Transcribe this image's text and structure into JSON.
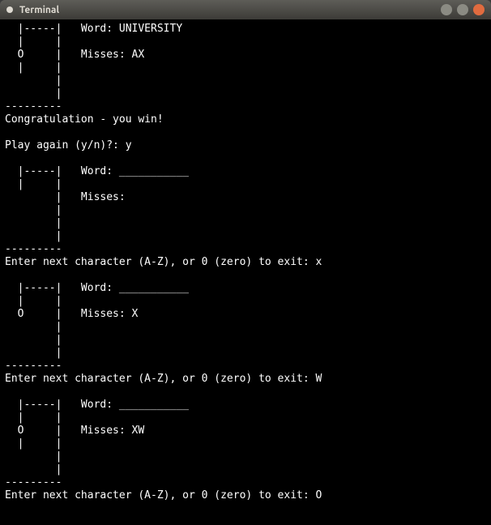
{
  "titlebar": {
    "title": "Terminal"
  },
  "game": {
    "round1": {
      "gallows": [
        "  |-----|   Word: UNIVERSITY",
        "  |     |",
        "  O     |   Misses: AX",
        "  |     |",
        "        |",
        "        |",
        "---------"
      ],
      "win_msg": "Congratulation - you win!",
      "play_again_prompt": "Play again (y/n)?: ",
      "play_again_answer": "y"
    },
    "round2": {
      "gallows": [
        "  |-----|   Word: ___________",
        "  |     |",
        "        |   Misses:",
        "        |",
        "        |",
        "        |",
        "---------"
      ],
      "prompt": "Enter next character (A-Z), or 0 (zero) to exit: ",
      "input": "x"
    },
    "round3": {
      "gallows": [
        "  |-----|   Word: ___________",
        "  |     |",
        "  O     |   Misses: X",
        "        |",
        "        |",
        "        |",
        "---------"
      ],
      "prompt": "Enter next character (A-Z), or 0 (zero) to exit: ",
      "input": "W"
    },
    "round4": {
      "gallows": [
        "  |-----|   Word: ___________",
        "  |     |",
        "  O     |   Misses: XW",
        "  |     |",
        "        |",
        "        |",
        "---------"
      ],
      "prompt": "Enter next character (A-Z), or 0 (zero) to exit: ",
      "input": "O"
    }
  }
}
